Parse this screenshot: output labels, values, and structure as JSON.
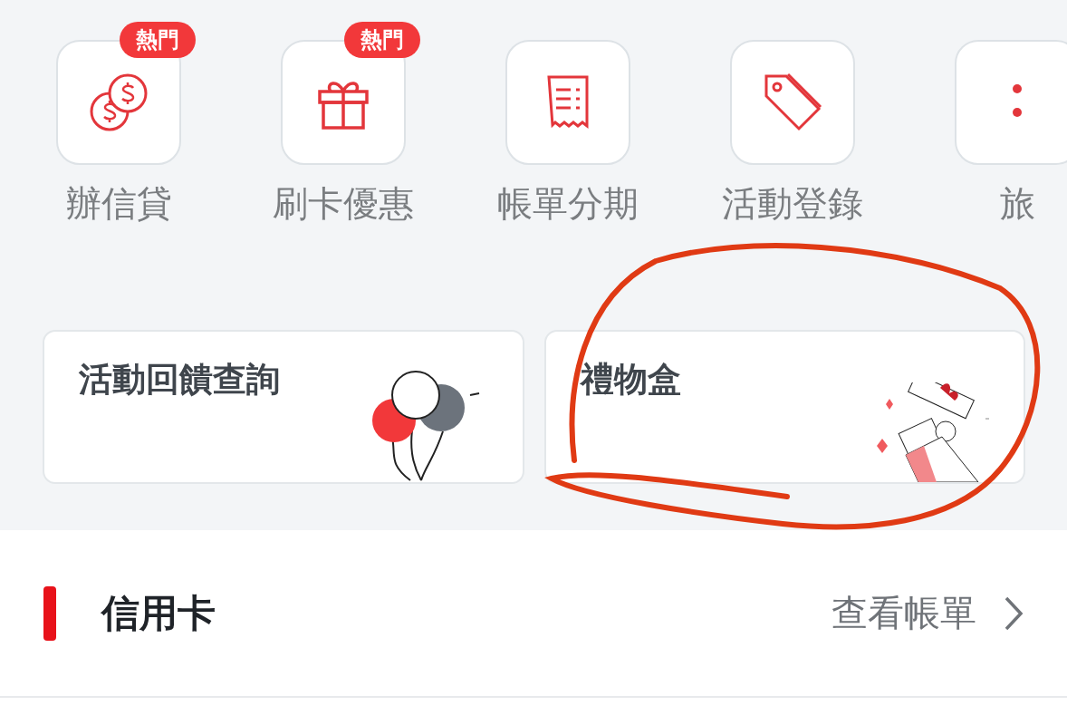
{
  "shortcuts": [
    {
      "label": "辦信貸",
      "badge": "熱門"
    },
    {
      "label": "刷卡優惠",
      "badge": "熱門"
    },
    {
      "label": "帳單分期"
    },
    {
      "label": "活動登錄"
    },
    {
      "label": "旅"
    }
  ],
  "cards": [
    {
      "title": "活動回饋查詢"
    },
    {
      "title": "禮物盒"
    }
  ],
  "section": {
    "title": "信用卡",
    "link": "查看帳單"
  }
}
